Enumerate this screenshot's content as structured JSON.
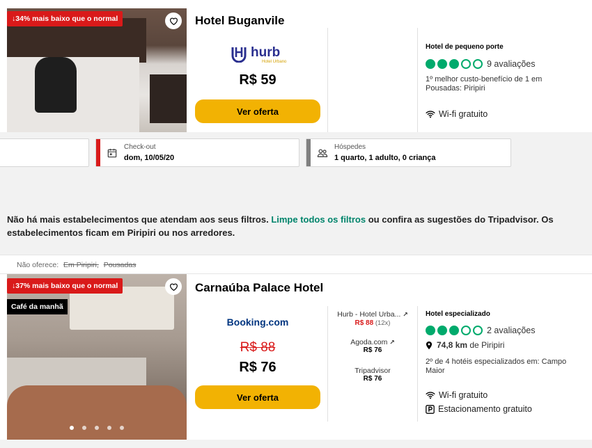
{
  "card1": {
    "deal_badge": "↓34% mais baixo que o normal",
    "hotel_name": "Hotel Buganvile",
    "provider_logo": "hurb",
    "provider_logo_sub": "Hotel Urbano",
    "price": "R$ 59",
    "offer_button": "Ver oferta",
    "category": "Hotel de pequeno porte",
    "reviews": "9 avaliações",
    "rating_filled": 3,
    "ranking": "1º melhor custo-benefício de 1 em Pousadas: Piripiri",
    "amenity_wifi": "Wi-fi gratuito"
  },
  "datebar": {
    "checkout_caption": "Check-out",
    "checkout_value": "dom, 10/05/20",
    "guests_caption": "Hóspedes",
    "guests_value": "1 quarto, 1 adulto, 0 criança"
  },
  "notice": {
    "text_before": "Não há mais estabelecimentos que atendam aos seus filtros. ",
    "link": "Limpe todos os filtros",
    "text_after": " ou confira as sugestões do Tripadvisor. Os estabelecimentos ficam em Piripiri ou nos arredores."
  },
  "card2": {
    "not_offer_label": "Não oferece:",
    "not_offer_items": [
      "Em Piripiri,",
      "Pousadas"
    ],
    "deal_badge": "↓37% mais baixo que o normal",
    "breakfast_badge": "Café da manhã",
    "hotel_name": "Carnaúba Palace Hotel",
    "provider_logo": "Booking.com",
    "old_price": "R$ 88",
    "price": "R$ 76",
    "offer_button": "Ver oferta",
    "providers": [
      {
        "name": "Hurb - Hotel Urba...",
        "price": "R$ 88",
        "extra": " (12x)"
      },
      {
        "name": "Agoda.com",
        "price": "R$ 76"
      },
      {
        "name": "Tripadvisor",
        "price": "R$ 76"
      }
    ],
    "category": "Hotel especializado",
    "reviews": "2 avaliações",
    "rating_filled": 3,
    "distance_bold": "74,8 km",
    "distance_rest": " de Piripiri",
    "ranking": "2º de 4 hotéis especializados em: Campo Maior",
    "amenity_wifi": "Wi-fi gratuito",
    "amenity_parking": "Estacionamento gratuito"
  },
  "colors": {
    "deal_red": "#d91a1a",
    "offer_yellow": "#f2b203",
    "rating_green": "#00aa6c",
    "link_green": "#00846b",
    "booking_blue": "#003580",
    "hurb_blue": "#2a2f8f"
  }
}
